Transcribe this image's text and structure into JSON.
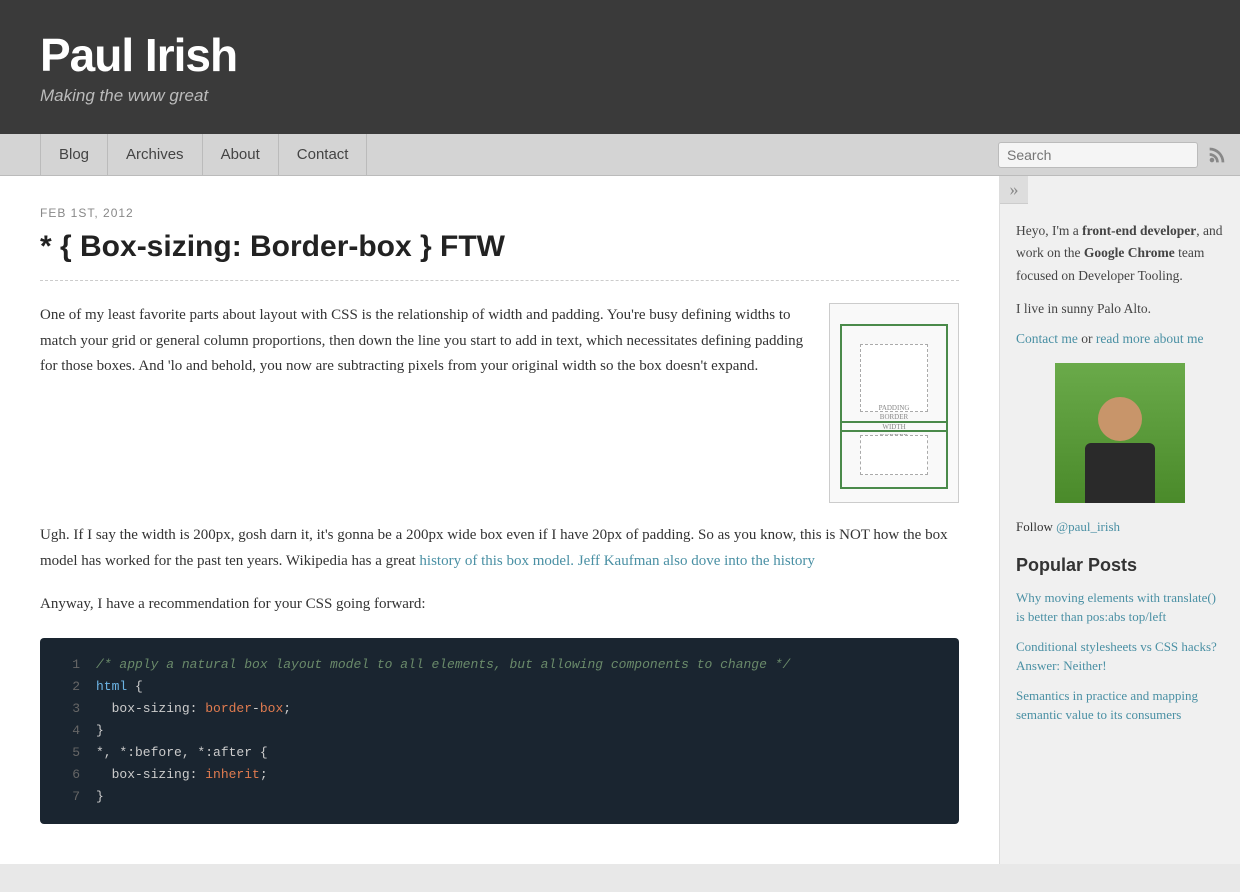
{
  "header": {
    "title": "Paul Irish",
    "subtitle": "Making the www great"
  },
  "nav": {
    "items": [
      {
        "label": "Blog",
        "id": "blog"
      },
      {
        "label": "Archives",
        "id": "archives"
      },
      {
        "label": "About",
        "id": "about"
      },
      {
        "label": "Contact",
        "id": "contact"
      }
    ],
    "search_placeholder": "Search"
  },
  "post": {
    "date": "FEB 1ST, 2012",
    "title": "* { Box-sizing: Border-box } FTW",
    "para1": "One of my least favorite parts about layout with CSS is the relationship of width and padding. You're busy defining widths to match your grid or general column proportions, then down the line you start to add in text, which necessitates defining padding for those boxes. And 'lo and behold, you now are subtracting pixels from your original width so the box doesn't expand.",
    "para2_prefix": "Ugh. If I say the width is 200px, gosh darn it, it's gonna be a 200px wide box even if I have 20px of padding. So as you know, this is NOT how the box model has worked for the past ten years. Wikipedia has a great ",
    "link1_text": "history of this box model.",
    "link2_text": "Jeff Kaufman also dove into the history",
    "para3": "Anyway, I have a recommendation for your CSS going forward:",
    "code": {
      "lines": [
        {
          "num": 1,
          "content": "/* apply a natural box layout model to all elements, but allowing components to change */",
          "type": "comment"
        },
        {
          "num": 2,
          "content": "html {",
          "type": "selector"
        },
        {
          "num": 3,
          "content": "  box-sizing: border-box;",
          "type": "property"
        },
        {
          "num": 4,
          "content": "}",
          "type": "normal"
        },
        {
          "num": 5,
          "content": "*, *:before, *:after {",
          "type": "selector"
        },
        {
          "num": 6,
          "content": "  box-sizing: inherit;",
          "type": "property"
        },
        {
          "num": 7,
          "content": "}",
          "type": "normal"
        }
      ]
    }
  },
  "sidebar": {
    "toggle_label": "»",
    "bio_part1": "Heyo, I'm a ",
    "bio_bold1": "front-end developer",
    "bio_part2": ", and work on the ",
    "bio_bold2": "Google Chrome",
    "bio_part3": " team focused on Developer Tooling.",
    "location": "I live in sunny Palo Alto.",
    "contact_link": "Contact me",
    "contact_or": " or ",
    "readmore_link": "read more about me",
    "follow_link": "@paul_irish",
    "follow_prefix": "Follow ",
    "popular_title": "Popular Posts",
    "popular_posts": [
      {
        "text": "Why moving elements with translate() is better than pos:abs top/left"
      },
      {
        "text": "Conditional stylesheets vs CSS hacks? Answer: Neither!"
      },
      {
        "text": "Semantics in practice and mapping semantic value to its consumers"
      }
    ]
  }
}
